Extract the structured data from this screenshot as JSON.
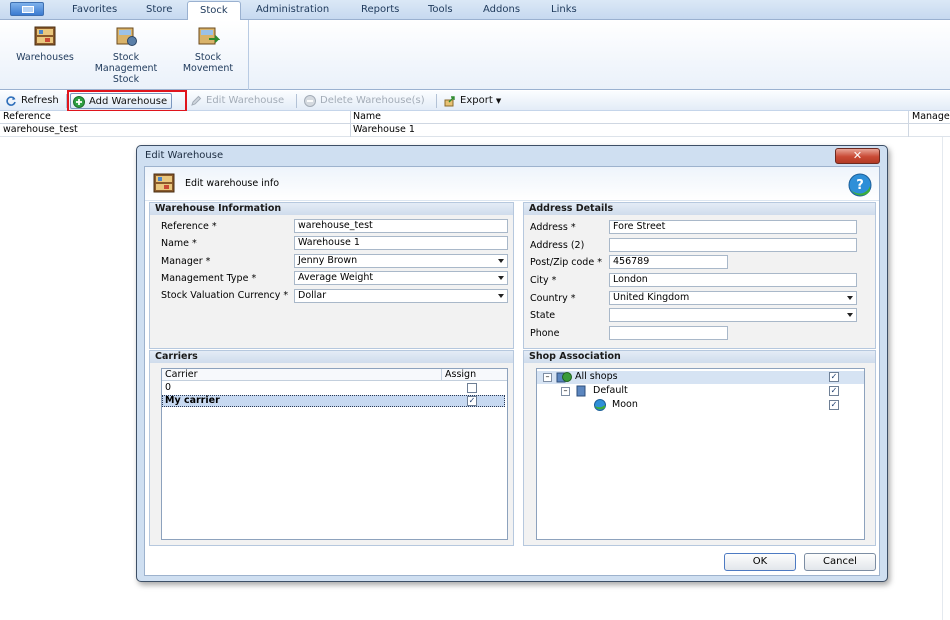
{
  "menu": {
    "tabs": [
      "Favorites",
      "Store",
      "Stock",
      "Administration",
      "Reports",
      "Tools",
      "Addons",
      "Links"
    ],
    "active_tab": "Stock"
  },
  "ribbon": {
    "warehouses": "Warehouses",
    "stock_management_l1": "Stock",
    "stock_management_l2": "Management",
    "stock_management_l3": "Stock",
    "stock_movement_l1": "Stock",
    "stock_movement_l2": "Movement"
  },
  "toolbar": {
    "refresh": "Refresh",
    "add_warehouse": "Add Warehouse",
    "edit_warehouse": "Edit Warehouse",
    "delete_warehouse": "Delete Warehouse(s)",
    "export": "Export"
  },
  "grid": {
    "columns": [
      "Reference",
      "Name",
      "Manage"
    ],
    "rows": [
      [
        "warehouse_test",
        "Warehouse 1"
      ]
    ]
  },
  "dialog": {
    "title": "Edit Warehouse",
    "header": "Edit warehouse info",
    "warehouse_info": {
      "heading": "Warehouse Information",
      "reference_label": "Reference *",
      "reference_value": "warehouse_test",
      "name_label": "Name *",
      "name_value": "Warehouse 1",
      "manager_label": "Manager *",
      "manager_value": "Jenny Brown",
      "mgmt_type_label": "Management Type *",
      "mgmt_type_value": "Average Weight",
      "currency_label": "Stock Valuation Currency *",
      "currency_value": "Dollar"
    },
    "address": {
      "heading": "Address Details",
      "address_label": "Address *",
      "address_value": "Fore Street",
      "address2_label": "Address (2)",
      "address2_value": "",
      "postcode_label": "Post/Zip code *",
      "postcode_value": "456789",
      "city_label": "City *",
      "city_value": "London",
      "country_label": "Country *",
      "country_value": "United Kingdom",
      "state_label": "State",
      "state_value": "",
      "phone_label": "Phone",
      "phone_value": ""
    },
    "carriers": {
      "heading": "Carriers",
      "col_carrier": "Carrier",
      "col_assign": "Assign",
      "rows": [
        {
          "name": "0",
          "assigned": false
        },
        {
          "name": "My carrier",
          "assigned": true
        }
      ]
    },
    "shops": {
      "heading": "Shop Association",
      "items": [
        {
          "label": "All shops",
          "checked": true
        },
        {
          "label": "Default",
          "checked": true
        },
        {
          "label": "Moon",
          "checked": true
        }
      ]
    },
    "ok": "OK",
    "cancel": "Cancel"
  },
  "colors": {
    "highlight": "#e0141c",
    "accent": "#3b7bd0",
    "dialog_frame": "#cfdff1"
  }
}
